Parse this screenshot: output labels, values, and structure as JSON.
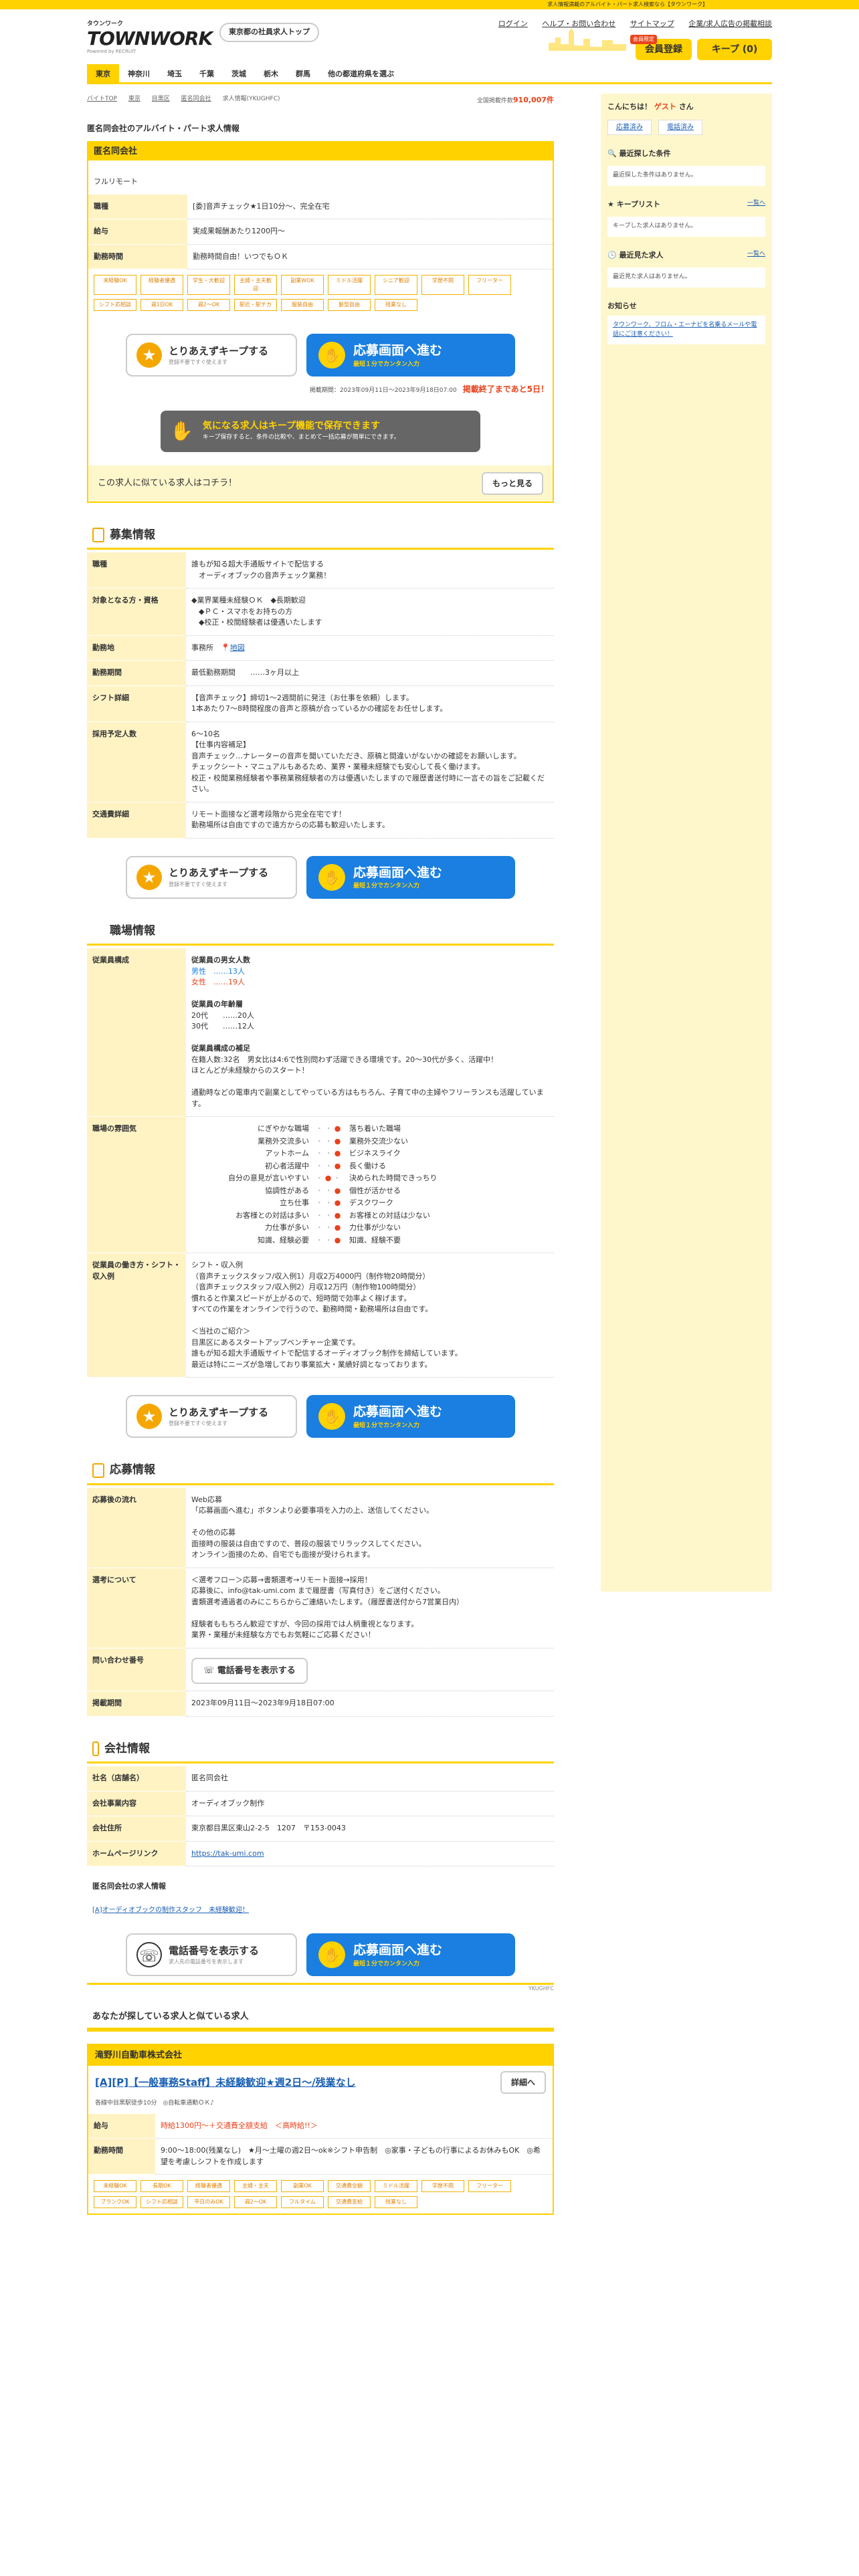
{
  "topbar": "求人情報満載のアルバイト・パート求人検索なら【タウンワーク】",
  "header": {
    "logo_small": "タウンワーク",
    "logo_big": "TOWNWORK",
    "logo_by": "Powered by RECRUIT",
    "region_btn": "東京都の社員求人トップ",
    "links": [
      "ログイン",
      "ヘルプ・お問い合わせ",
      "サイトマップ",
      "企業/求人広告の掲載相談"
    ],
    "reg_badge": "会員限定",
    "reg": "会員登録",
    "keep": "キープ (0)"
  },
  "nav": [
    "東京",
    "神奈川",
    "埼玉",
    "千葉",
    "茨城",
    "栃木",
    "群馬",
    "他の都道府県を選ぶ"
  ],
  "crumbs": [
    "バイトTOP",
    "東京",
    "目黒区",
    "匿名同会社",
    "求人情報(YKUGHFC)"
  ],
  "total": {
    "label": "全国掲載件数",
    "count": "910,007件"
  },
  "page_title": "匿名同会社のアルバイト・パート求人情報",
  "job": {
    "company": "匿名同会社",
    "type": "フルリモート",
    "rows": [
      {
        "k": "職種",
        "v": "[委]音声チェック★1日10分〜、完全在宅"
      },
      {
        "k": "給与",
        "v": "実成果報酬あたり1200円〜"
      },
      {
        "k": "勤務時間",
        "v": "勤務時間自由！いつでもＯＫ"
      }
    ],
    "tags": [
      "未経験OK",
      "経験者優遇",
      "学生・大歓迎",
      "主婦・主夫歓迎",
      "副業WOK",
      "ミドル活躍",
      "シニア歓迎",
      "学歴不問",
      "フリーター",
      "シフト応相談",
      "週1日OK",
      "週2〜OK",
      "駅近・駅チカ",
      "服装自由",
      "髪型自由",
      "残業なし"
    ],
    "period": "掲載期間：2023年09月11日〜2023年9月18日07:00",
    "deadline": "掲載終了まであと5日！"
  },
  "buttons": {
    "keep": "とりあえずキープする",
    "keep_sub": "登録不要ですぐ使えます",
    "apply": "応募画面へ進む",
    "apply_sub": "最短１分でカンタン入力",
    "phone": "電話番号を表示する",
    "phone_sub": "求人先の電話番号を表示します",
    "more": "もっと見る",
    "detail": "詳細へ"
  },
  "banner": {
    "t1": "気になる求人はキープ機能で保存できます",
    "t2": "キープ保存すると、条件の比較や、まとめて一括応募が簡単にできます。"
  },
  "similar": "この求人に似ている求人はコチラ！",
  "recruit": {
    "title": "募集情報",
    "rows": [
      {
        "k": "職種",
        "v": "誰もが知る超大手通販サイトで配信する\n　オーディオブックの音声チェック業務！"
      },
      {
        "k": "対象となる方・資格",
        "v": "◆業界業種未経験ＯＫ　◆長期歓迎\n　◆ＰＣ・スマホをお持ちの方\n　◆校正・校閲経験者は優遇いたします"
      },
      {
        "k": "勤務地",
        "v": "事務所"
      },
      {
        "k": "勤務期間",
        "v": "最低勤務期間　　……3ヶ月以上"
      },
      {
        "k": "シフト詳細",
        "v": "【音声チェック】締切1〜2週間前に発注（お仕事を依頼）します。\n1本あたり7〜8時間程度の音声と原稿が合っているかの確認をお任せします。"
      },
      {
        "k": "採用予定人数",
        "v": "6〜10名\n【仕事内容補足】\n音声チェック…ナレーターの音声を聞いていただき、原稿と間違いがないかの確認をお願いします。\nチェックシート・マニュアルもあるため、業界・業種未経験でも安心して長く働けます。\n校正・校閲業務経験者や事務業務経験者の方は優遇いたしますので履歴書送付時に一言その旨をご記載ください。"
      },
      {
        "k": "交通費詳細",
        "v": "リモート面接など選考段階から完全在宅です！\n勤務場所は自由ですので遠方からの応募も歓迎いたします。"
      }
    ],
    "map": "地図"
  },
  "workplace": {
    "title": "職場情報",
    "composition": "従業員構成",
    "gender_title": "従業員の男女人数",
    "male": "男性　……13人",
    "female": "女性　……19人",
    "age_title": "従業員の年齢層",
    "age20": "20代　　……20人",
    "age30": "30代　　……12人",
    "supp_title": "従業員構成の補足",
    "supp": "在籍人数:32名　男女比は4:6で性別問わず活躍できる環境です。20〜30代が多く、活躍中！\nほとんどが未経験からのスタート！\n\n通勤時などの電車内で副業としてやっている方はもちろん、子育て中の主婦やフリーランスも活躍しています。",
    "mood_k": "職場の雰囲気",
    "mood": [
      [
        "にぎやかな職場",
        "落ち着いた職場",
        3
      ],
      [
        "業務外交流多い",
        "業務外交流少ない",
        3
      ],
      [
        "アットホーム",
        "ビジネスライク",
        3
      ],
      [
        "初心者活躍中",
        "長く働ける",
        3
      ],
      [
        "自分の意見が言いやすい",
        "決められた時間できっちり",
        2
      ],
      [
        "協調性がある",
        "個性が活かせる",
        3
      ],
      [
        "立ち仕事",
        "デスクワーク",
        3
      ],
      [
        "お客様との対話は多い",
        "お客様との対話は少ない",
        3
      ],
      [
        "力仕事が多い",
        "力仕事が少ない",
        3
      ],
      [
        "知識、経験必要",
        "知識、経験不要",
        3
      ]
    ],
    "shift_k": "従業員の働き方・シフト・収入例",
    "shift": "シフト・収入例\n（音声チェックスタッフ/収入例1）月収2万4000円（制作物20時間分）\n（音声チェックスタッフ/収入例2）月収12万円（制作物100時間分）\n慣れると作業スピードが上がるので、短時間で効率よく稼げます。\nすべての作業をオンラインで行うので、勤務時間・勤務場所は自由です。\n\n＜当社のご紹介＞\n目黒区にあるスタートアップベンチャー企業です。\n誰もが知る超大手通販サイトで配信するオーディオブック制作を締結しています。\n最近は特にニーズが急増しており事業拡大・業績好調となっております。"
  },
  "apply": {
    "title": "応募情報",
    "rows": [
      {
        "k": "応募後の流れ",
        "v": "Web応募\n「応募画面へ進む」ボタンより必要事項を入力の上、送信してください。\n\nその他の応募\n面接時の服装は自由ですので、普段の服装でリラックスしてください。\nオンライン面接のため、自宅でも面接が受けられます。"
      },
      {
        "k": "選考について",
        "v": "＜選考フロー＞応募→書類選考→リモート面接→採用！\n応募後に、info@tak-umi.com まで履歴書（写真付き）をご送付ください。\n書類選考通過者のみにこちらからご連絡いたします。（履歴書送付から7営業日内）\n\n経験者ももちろん歓迎ですが、今回の採用では人柄重視となります。\n業界・業種が未経験な方でもお気軽にご応募ください！"
      },
      {
        "k": "問い合わせ番号",
        "v": ""
      },
      {
        "k": "掲載期間",
        "v": "2023年09月11日〜2023年9月18日07:00"
      }
    ]
  },
  "company": {
    "title": "会社情報",
    "rows": [
      {
        "k": "社名（店舗名）",
        "v": "匿名同会社"
      },
      {
        "k": "会社事業内容",
        "v": "オーディオブック制作"
      },
      {
        "k": "会社住所",
        "v": "東京都目黒区東山2-2-5　1207　〒153-0043"
      },
      {
        "k": "ホームページリンク",
        "v": "https://tak-umi.com"
      }
    ],
    "jobs_title": "匿名同会社の求人情報",
    "job_link": "[A]オーディオブックの制作スタッフ　未経験歓迎！",
    "code": "YKUGHFC"
  },
  "also": {
    "title": "あなたが探している求人と似ている求人",
    "company": "滝野川自動車株式会社",
    "link": "[A][P]【一般事務Staff】未経験歓迎★週2日〜/残業なし",
    "sub": "各線中目黒駅徒歩10分　◎自転車通勤ＯＫ♪",
    "wage_k": "給与",
    "wage": "時給1300円〜＋交通費全額支給　＜高時給!!＞",
    "time_k": "勤務時間",
    "time": "9:00〜18:00(残業なし)　★月〜土曜の週2日〜ok※シフト申告制　◎家事・子どもの行事によるお休みもOK　◎希望を考慮しシフトを作成します",
    "tags": [
      "未経験OK",
      "長期OK",
      "経験者優遇",
      "主婦・主夫",
      "副業OK",
      "交通費全額",
      "ミドル活躍",
      "学歴不問",
      "フリーター",
      "ブランクOK",
      "シフト応相談",
      "平日のみOK",
      "週2〜OK",
      "フルタイム",
      "交通費支給",
      "残業なし"
    ]
  },
  "side": {
    "hello": "こんにちは！",
    "guest": "ゲスト",
    "san": "さん",
    "btn1": "応募済み",
    "btn2": "電話済み",
    "recent_cond": "最近探した条件",
    "recent_cond_empty": "最近探した条件はありません。",
    "keep_list": "キープリスト",
    "view_all": "一覧へ",
    "keep_empty": "キープした求人はありません。",
    "recent_jobs": "最近見た求人",
    "recent_jobs_empty": "最近見た求人はありません。",
    "notice": "お知らせ",
    "notice_link": "タウンワーク、フロム・エーナビを名乗るメールや電話にご注意ください！"
  }
}
